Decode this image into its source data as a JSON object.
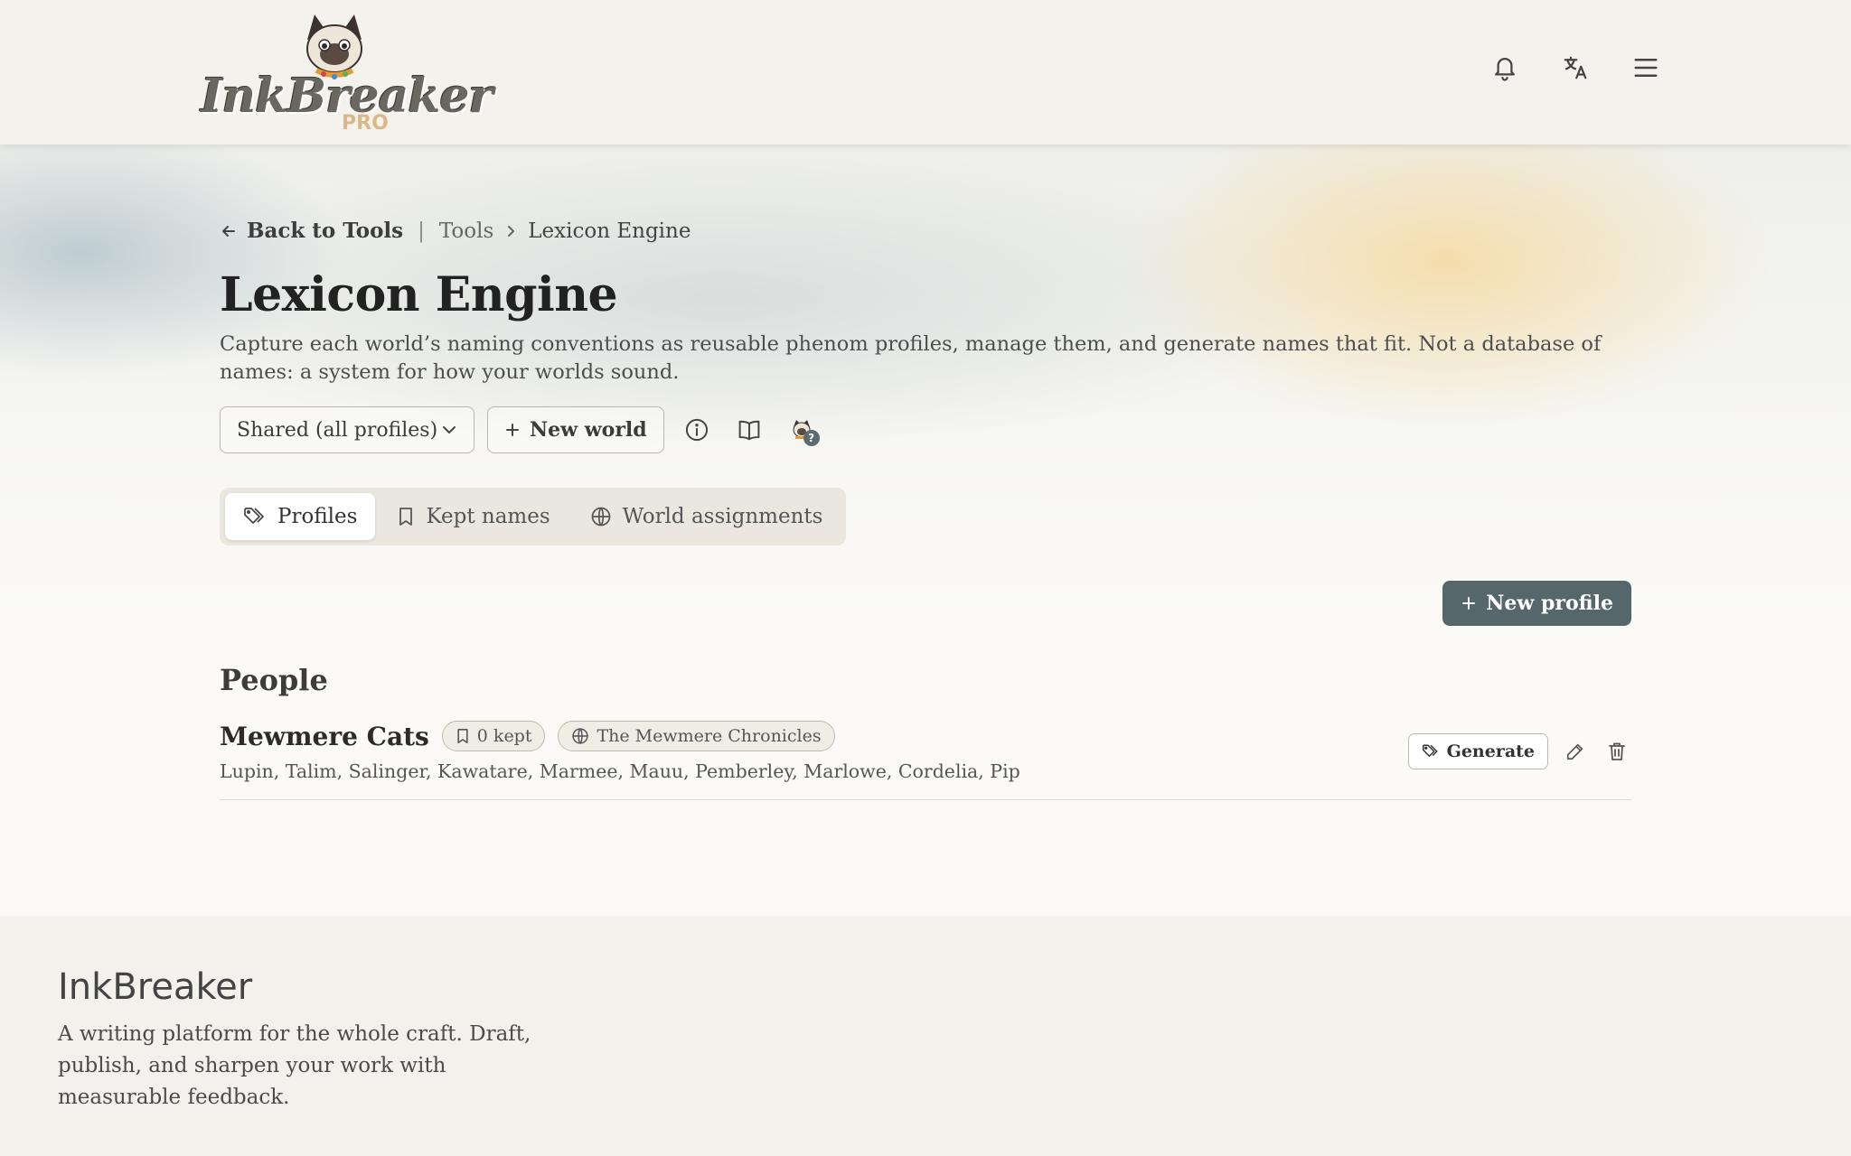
{
  "header": {
    "logo_word": "InkBreaker",
    "logo_badge": "PRO",
    "icons": [
      "bell-icon",
      "translate-icon",
      "hamburger-menu-icon"
    ]
  },
  "breadcrumb": {
    "back_label": "Back to Tools",
    "tools_label": "Tools",
    "current_label": "Lexicon Engine"
  },
  "page": {
    "title": "Lexicon Engine",
    "description": "Capture each world’s naming conventions as reusable phenom profiles, manage them, and generate names that fit. Not a database of names: a system for how your worlds sound."
  },
  "toolbar": {
    "world_select_value": "Shared (all profiles)",
    "new_world_label": "New world",
    "help_badge": "?"
  },
  "tabs": [
    {
      "label": "Profiles",
      "icon": "tags-icon",
      "active": true
    },
    {
      "label": "Kept names",
      "icon": "bookmark-icon",
      "active": false
    },
    {
      "label": "World assignments",
      "icon": "globe-icon",
      "active": false
    }
  ],
  "actions": {
    "new_profile_label": "New profile"
  },
  "sections": [
    {
      "title": "People",
      "profiles": [
        {
          "name": "Mewmere Cats",
          "kept_label": "0 kept",
          "world_label": "The Mewmere Chronicles",
          "sample_names": "Lupin, Talim, Salinger, Kawatare, Marmee, Mauu, Pemberley, Marlowe, Cordelia, Pip",
          "generate_label": "Generate"
        }
      ]
    }
  ],
  "footer": {
    "brand": "InkBreaker",
    "tagline": "A writing platform for the whole craft. Draft, publish, and sharpen your work with measurable feedback."
  },
  "colors": {
    "primary_button": "#56676c",
    "background": "#fbfaf7",
    "footer_bg": "#f3f1ec"
  }
}
